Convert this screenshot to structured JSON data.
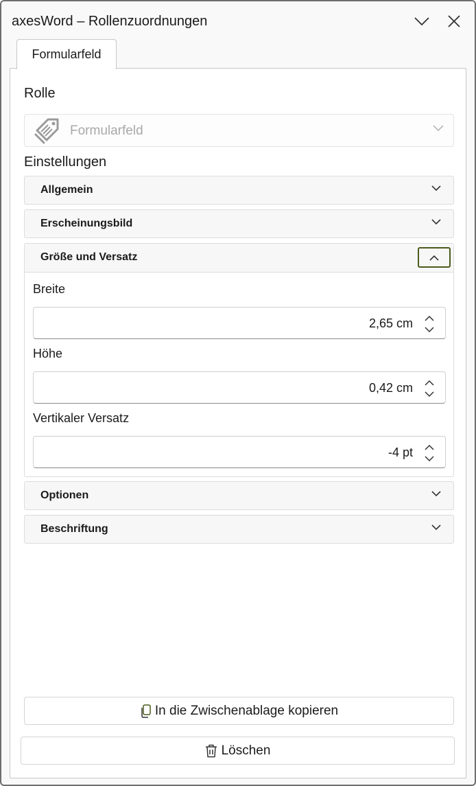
{
  "window": {
    "title": "axesWord – Rollenzuordnungen"
  },
  "tabs": [
    {
      "label": "Formularfeld"
    }
  ],
  "role": {
    "label": "Rolle",
    "selected": "Formularfeld"
  },
  "settings": {
    "label": "Einstellungen",
    "sections": [
      {
        "title": "Allgemein",
        "expanded": false
      },
      {
        "title": "Erscheinungsbild",
        "expanded": false
      },
      {
        "title": "Größe und Versatz",
        "expanded": true
      },
      {
        "title": "Optionen",
        "expanded": false
      },
      {
        "title": "Beschriftung",
        "expanded": false
      }
    ],
    "size_offset": {
      "fields": [
        {
          "label": "Breite",
          "value": "2,65 cm"
        },
        {
          "label": "Höhe",
          "value": "0,42 cm"
        },
        {
          "label": "Vertikaler Versatz",
          "value": "-4 pt"
        }
      ]
    }
  },
  "buttons": {
    "copy": "In die Zwischenablage kopieren",
    "delete": "Löschen"
  },
  "colors": {
    "focus_border": "#4a5a1c",
    "icon_gray": "#8a8a8a",
    "placeholder_text": "#a8a8a8"
  },
  "icons": [
    "chevron-down-icon",
    "close-icon",
    "form-field-tag-icon",
    "chevron-up-icon",
    "clipboard-icon",
    "trash-icon"
  ]
}
